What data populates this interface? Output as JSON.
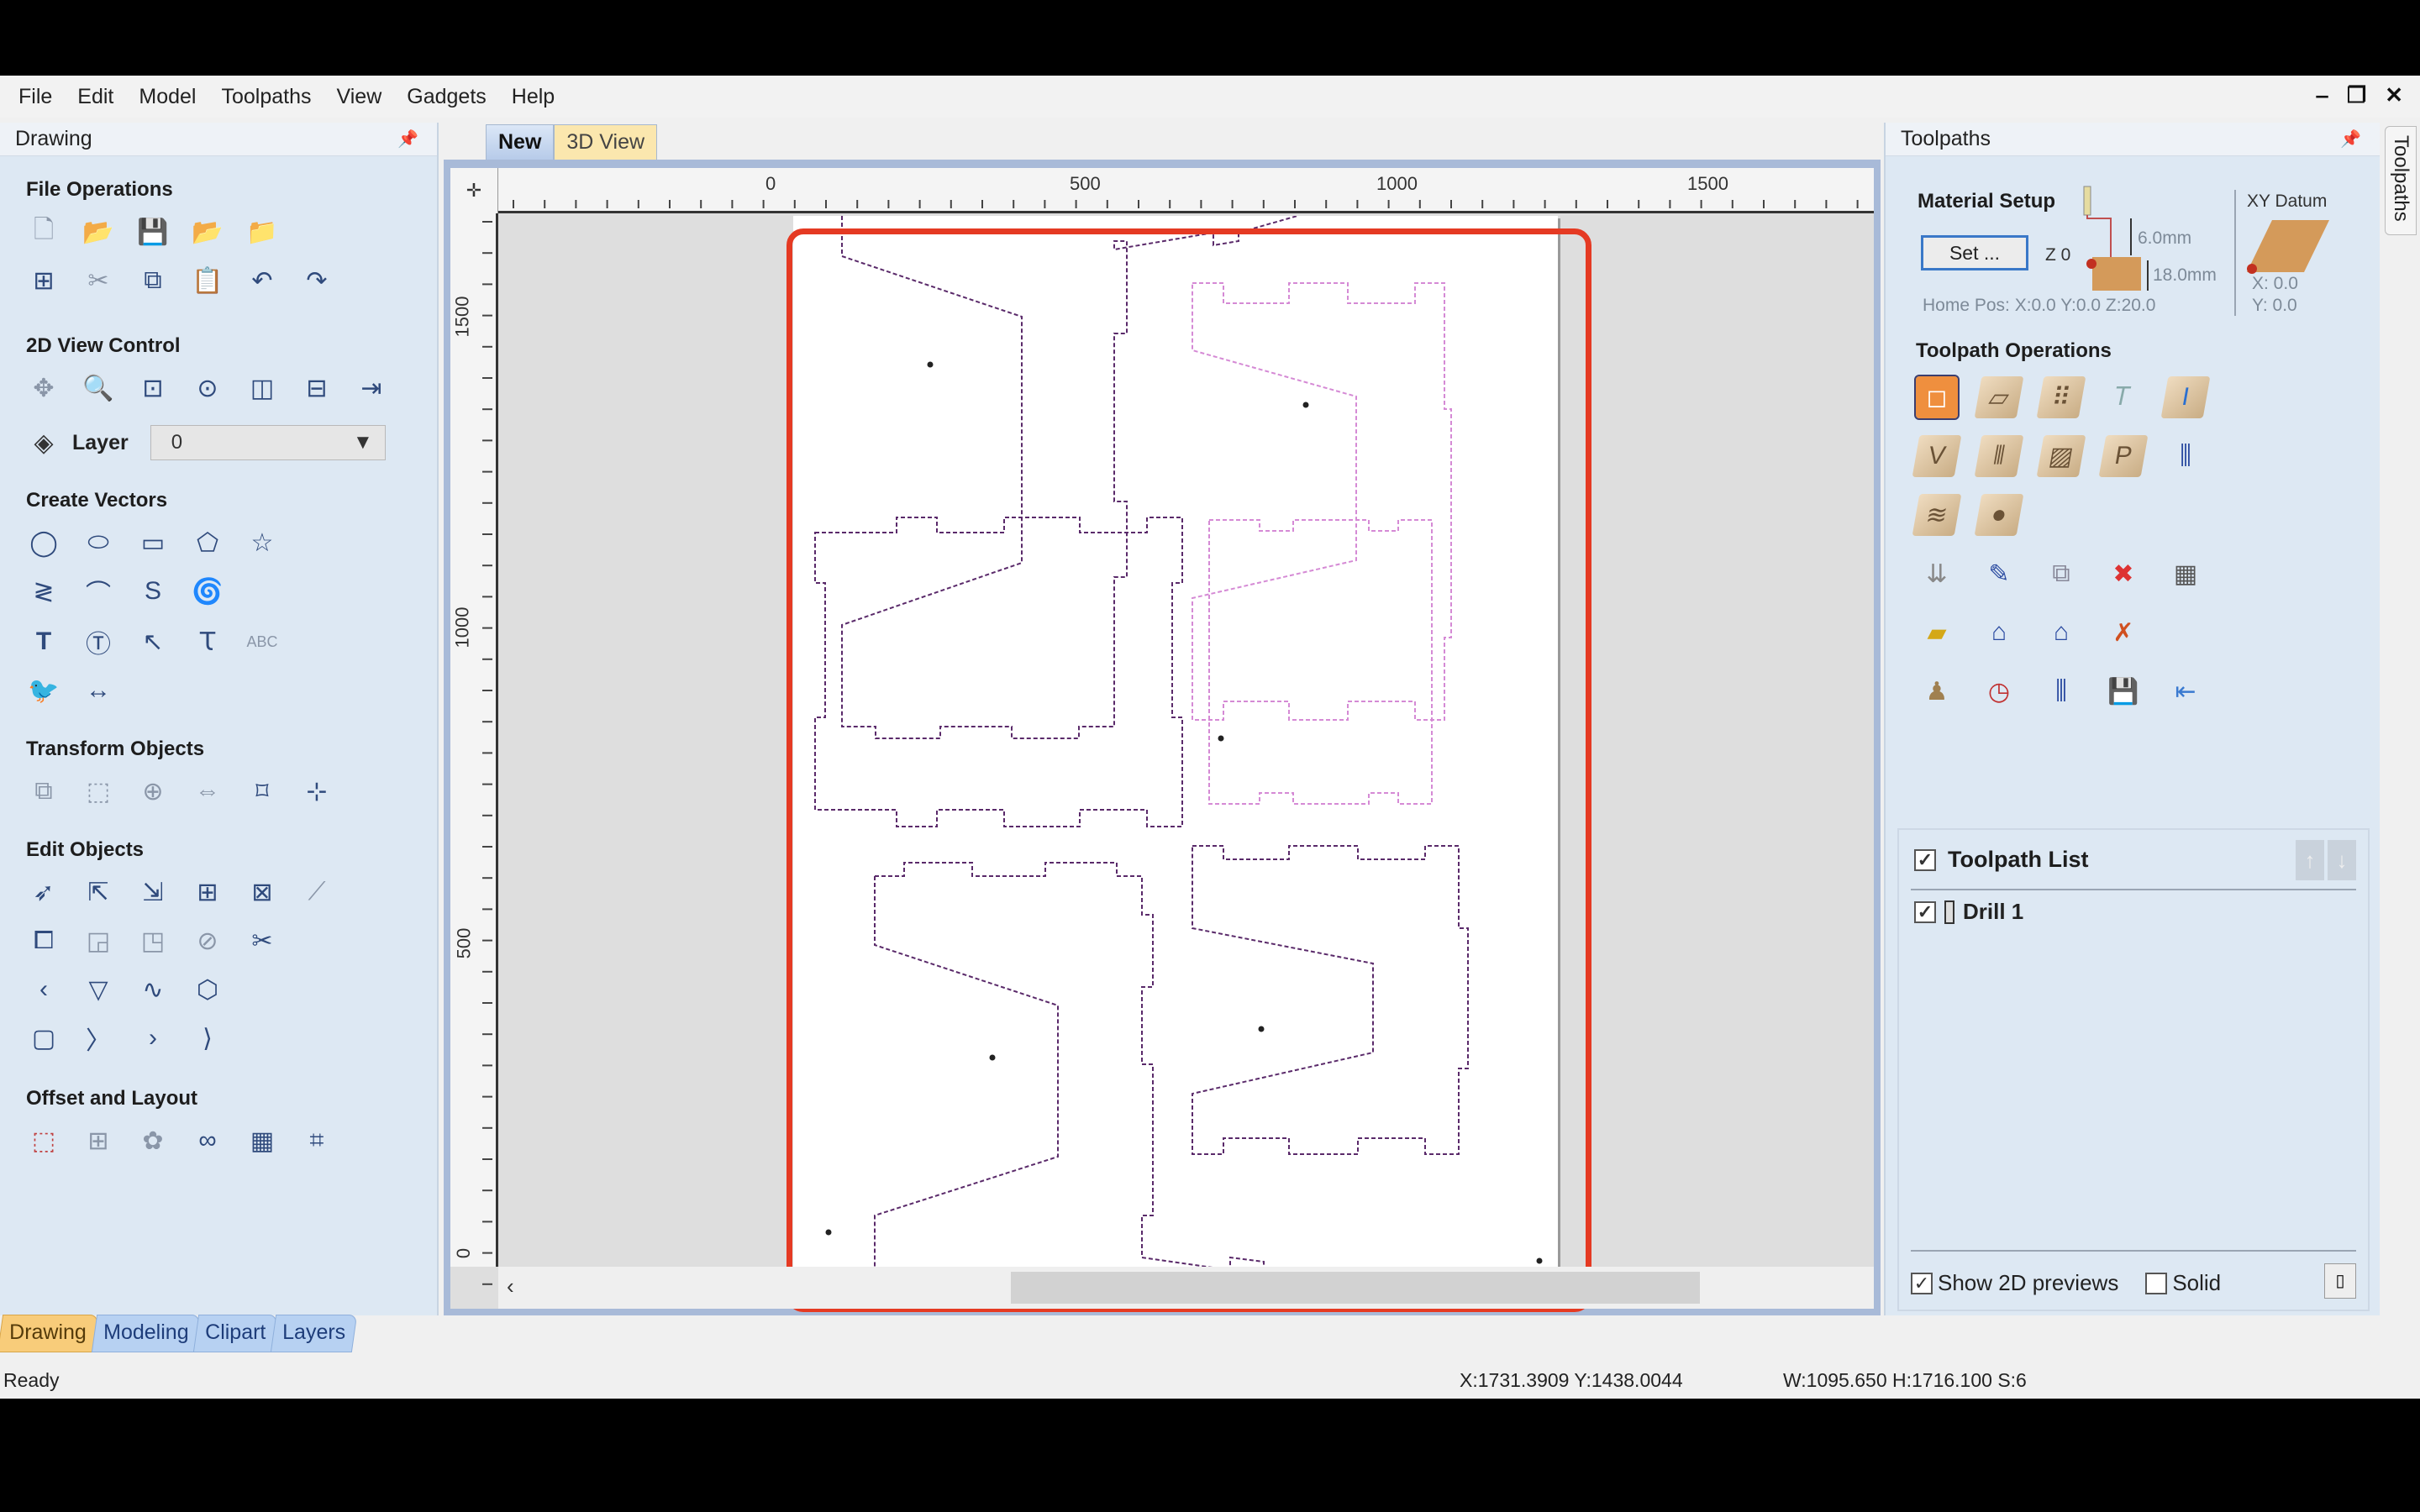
{
  "menu": [
    "File",
    "Edit",
    "Model",
    "Toolpaths",
    "View",
    "Gadgets",
    "Help"
  ],
  "window_controls": {
    "minimize": "‒",
    "restore": "❐",
    "close": "✕"
  },
  "left_panel": {
    "title": "Drawing",
    "sections": {
      "file_operations": "File Operations",
      "view_control": "2D View Control",
      "create_vectors": "Create Vectors",
      "transform_objects": "Transform Objects",
      "edit_objects": "Edit Objects",
      "offset_layout": "Offset and Layout"
    },
    "layer": {
      "label": "Layer",
      "value": "0"
    },
    "bottom_tabs": [
      "Drawing",
      "Modeling",
      "Clipart",
      "Layers"
    ]
  },
  "canvas": {
    "tabs": [
      "New",
      "3D View"
    ],
    "ruler_top": [
      "0",
      "500",
      "1000",
      "1500"
    ],
    "ruler_left": [
      "1500",
      "1000",
      "500",
      "0"
    ],
    "scroll_left_arrow": "‹"
  },
  "right_panel": {
    "title": "Toolpaths",
    "vertical_tab": "Toolpaths",
    "material_setup": {
      "title": "Material Setup",
      "set_button": "Set ...",
      "z_label": "Z 0",
      "clearance": "6.0mm",
      "thickness": "18.0mm",
      "home_pos": "Home Pos:   X:0.0 Y:0.0 Z:20.0"
    },
    "xy_datum": {
      "title": "XY Datum",
      "x": "X: 0.0",
      "y": "Y: 0.0"
    },
    "operations_title": "Toolpath Operations",
    "toolpath_list": {
      "title": "Toolpath List",
      "items": [
        {
          "name": "Drill 1",
          "checked": true
        }
      ]
    },
    "show_2d_previews": {
      "label": "Show 2D previews",
      "checked": true
    },
    "solid": {
      "label": "Solid",
      "checked": false
    }
  },
  "status": {
    "ready": "Ready",
    "cursor": "X:1731.3909 Y:1438.0044",
    "dims": "W:1095.650  H:1716.100  S:6"
  },
  "colors": {
    "highlight": "#e53a23",
    "vector_selected": "#5a2a6a",
    "vector_unselected": "#d58ad5",
    "tab_active": "#f8cc7a"
  }
}
